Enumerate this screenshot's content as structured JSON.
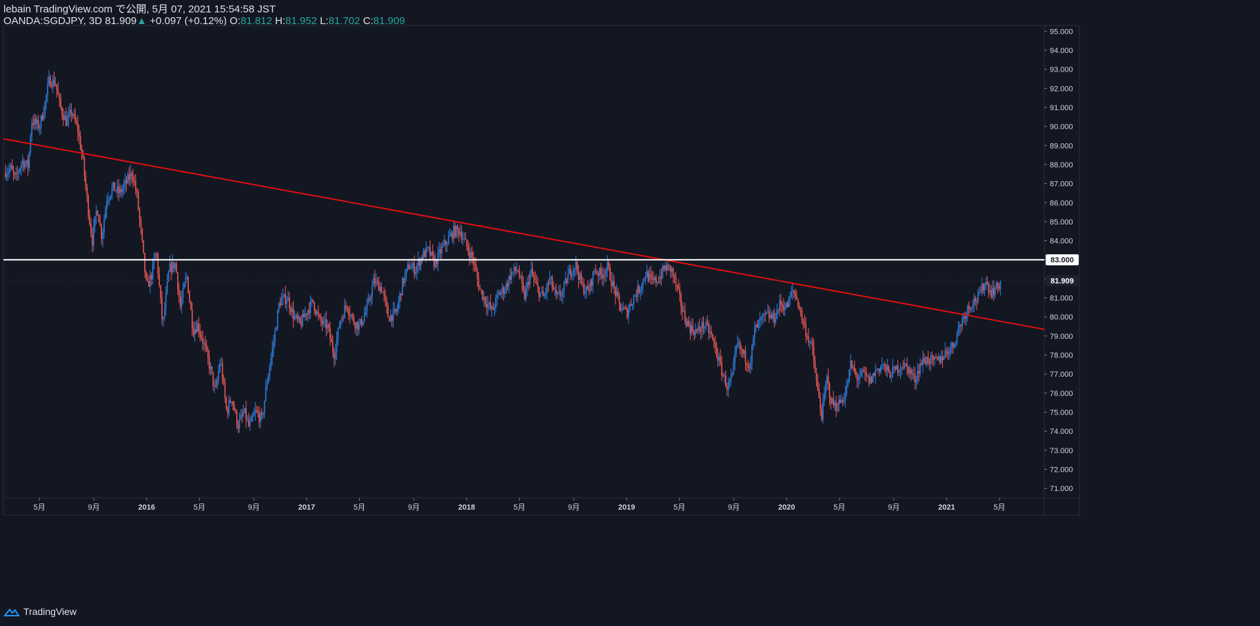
{
  "header": {
    "line1": "lebain TradingView.com で公開, 5月 07, 2021 15:54:58 JST",
    "symbol": "OANDA:SGDJPY, 3D",
    "last": "81.909",
    "change_arrow": "▲",
    "change": "+0.097 (+0.12%)",
    "o_label": "O:",
    "o_val": "81.812",
    "h_label": "H:",
    "h_val": "81.952",
    "l_label": "L:",
    "l_val": "81.702",
    "c_label": "C:",
    "c_val": "81.909"
  },
  "footer": {
    "brand": "TradingView"
  },
  "colors": {
    "background": "#131722",
    "up_candle": "#2f7fe0",
    "down_candle": "#f05a55",
    "trendline": "#e01010",
    "hline": "#ffffff",
    "axis_text": "#d1d4dc",
    "price_label_bg": "#ffffff",
    "last_label_bg": "#1e2230"
  },
  "chart_data": {
    "type": "candlestick",
    "symbol": "OANDA:SGDJPY",
    "timeframe": "3D",
    "ylim": [
      70.5,
      95.3
    ],
    "y_ticks": [
      "95.000",
      "94.000",
      "93.000",
      "92.000",
      "91.000",
      "90.000",
      "89.000",
      "88.000",
      "87.000",
      "86.000",
      "85.000",
      "84.000",
      "83.000",
      "82.000",
      "81.000",
      "80.000",
      "79.000",
      "78.000",
      "77.000",
      "76.000",
      "75.000",
      "74.000",
      "73.000",
      "72.000",
      "71.000"
    ],
    "x_ticks": [
      {
        "label": "5月",
        "year_frac": 2015.33
      },
      {
        "label": "9月",
        "year_frac": 2015.67
      },
      {
        "label": "2016",
        "year_frac": 2016.0
      },
      {
        "label": "5月",
        "year_frac": 2016.33
      },
      {
        "label": "9月",
        "year_frac": 2016.67
      },
      {
        "label": "2017",
        "year_frac": 2017.0
      },
      {
        "label": "5月",
        "year_frac": 2017.33
      },
      {
        "label": "9月",
        "year_frac": 2017.67
      },
      {
        "label": "2018",
        "year_frac": 2018.0
      },
      {
        "label": "5月",
        "year_frac": 2018.33
      },
      {
        "label": "9月",
        "year_frac": 2018.67
      },
      {
        "label": "2019",
        "year_frac": 2019.0
      },
      {
        "label": "5月",
        "year_frac": 2019.33
      },
      {
        "label": "9月",
        "year_frac": 2019.67
      },
      {
        "label": "2020",
        "year_frac": 2020.0
      },
      {
        "label": "5月",
        "year_frac": 2020.33
      },
      {
        "label": "9月",
        "year_frac": 2020.67
      },
      {
        "label": "2021",
        "year_frac": 2021.0
      },
      {
        "label": "5月",
        "year_frac": 2021.33
      }
    ],
    "x_range": [
      2015.105,
      2021.61
    ],
    "path_points": [
      [
        2015.11,
        87.6
      ],
      [
        2015.15,
        87.8
      ],
      [
        2015.18,
        87.2
      ],
      [
        2015.22,
        88.2
      ],
      [
        2015.26,
        87.9
      ],
      [
        2015.28,
        90.3
      ],
      [
        2015.33,
        90.0
      ],
      [
        2015.36,
        91.0
      ],
      [
        2015.39,
        92.4
      ],
      [
        2015.43,
        92.3
      ],
      [
        2015.46,
        91.0
      ],
      [
        2015.5,
        90.2
      ],
      [
        2015.53,
        90.8
      ],
      [
        2015.57,
        89.8
      ],
      [
        2015.6,
        88.3
      ],
      [
        2015.63,
        86.0
      ],
      [
        2015.66,
        84.0
      ],
      [
        2015.69,
        85.8
      ],
      [
        2015.72,
        84.2
      ],
      [
        2015.75,
        86.2
      ],
      [
        2015.79,
        86.8
      ],
      [
        2015.83,
        86.5
      ],
      [
        2015.87,
        87.0
      ],
      [
        2015.91,
        87.6
      ],
      [
        2015.94,
        86.3
      ],
      [
        2015.97,
        84.0
      ],
      [
        2016.0,
        81.5
      ],
      [
        2016.03,
        82.2
      ],
      [
        2016.06,
        83.5
      ],
      [
        2016.1,
        79.5
      ],
      [
        2016.14,
        82.5
      ],
      [
        2016.18,
        82.8
      ],
      [
        2016.21,
        80.5
      ],
      [
        2016.25,
        82.2
      ],
      [
        2016.29,
        79.3
      ],
      [
        2016.32,
        79.6
      ],
      [
        2016.36,
        78.5
      ],
      [
        2016.4,
        77.2
      ],
      [
        2016.43,
        76.0
      ],
      [
        2016.46,
        77.8
      ],
      [
        2016.5,
        75.0
      ],
      [
        2016.53,
        75.8
      ],
      [
        2016.57,
        74.3
      ],
      [
        2016.61,
        75.0
      ],
      [
        2016.64,
        74.2
      ],
      [
        2016.68,
        75.0
      ],
      [
        2016.72,
        74.6
      ],
      [
        2016.75,
        76.5
      ],
      [
        2016.79,
        78.5
      ],
      [
        2016.83,
        80.8
      ],
      [
        2016.88,
        81.0
      ],
      [
        2016.92,
        80.0
      ],
      [
        2016.96,
        79.6
      ],
      [
        2017.0,
        80.3
      ],
      [
        2017.04,
        80.8
      ],
      [
        2017.08,
        79.8
      ],
      [
        2017.13,
        79.5
      ],
      [
        2017.17,
        78.0
      ],
      [
        2017.21,
        79.8
      ],
      [
        2017.25,
        80.7
      ],
      [
        2017.29,
        79.8
      ],
      [
        2017.33,
        79.5
      ],
      [
        2017.38,
        80.5
      ],
      [
        2017.42,
        81.9
      ],
      [
        2017.47,
        81.5
      ],
      [
        2017.51,
        80.0
      ],
      [
        2017.56,
        80.2
      ],
      [
        2017.6,
        81.8
      ],
      [
        2017.64,
        82.7
      ],
      [
        2017.68,
        82.5
      ],
      [
        2017.72,
        83.2
      ],
      [
        2017.76,
        83.5
      ],
      [
        2017.8,
        82.8
      ],
      [
        2017.84,
        83.5
      ],
      [
        2017.88,
        84.0
      ],
      [
        2017.92,
        84.5
      ],
      [
        2017.96,
        84.5
      ],
      [
        2018.0,
        83.7
      ],
      [
        2018.04,
        83.0
      ],
      [
        2018.08,
        81.5
      ],
      [
        2018.12,
        80.8
      ],
      [
        2018.16,
        80.3
      ],
      [
        2018.2,
        81.2
      ],
      [
        2018.24,
        81.5
      ],
      [
        2018.28,
        82.3
      ],
      [
        2018.32,
        82.5
      ],
      [
        2018.36,
        81.0
      ],
      [
        2018.4,
        82.4
      ],
      [
        2018.44,
        81.5
      ],
      [
        2018.48,
        81.0
      ],
      [
        2018.52,
        82.0
      ],
      [
        2018.56,
        81.0
      ],
      [
        2018.6,
        81.3
      ],
      [
        2018.64,
        82.3
      ],
      [
        2018.68,
        82.8
      ],
      [
        2018.72,
        81.6
      ],
      [
        2018.76,
        81.3
      ],
      [
        2018.8,
        82.5
      ],
      [
        2018.84,
        82.2
      ],
      [
        2018.88,
        82.6
      ],
      [
        2018.92,
        81.5
      ],
      [
        2018.96,
        80.5
      ],
      [
        2019.0,
        80.2
      ],
      [
        2019.04,
        81.0
      ],
      [
        2019.08,
        81.5
      ],
      [
        2019.12,
        82.3
      ],
      [
        2019.16,
        81.8
      ],
      [
        2019.2,
        82.0
      ],
      [
        2019.24,
        82.6
      ],
      [
        2019.28,
        82.5
      ],
      [
        2019.32,
        81.3
      ],
      [
        2019.36,
        80.0
      ],
      [
        2019.4,
        79.4
      ],
      [
        2019.44,
        79.2
      ],
      [
        2019.48,
        79.6
      ],
      [
        2019.52,
        79.2
      ],
      [
        2019.56,
        78.2
      ],
      [
        2019.6,
        77.0
      ],
      [
        2019.63,
        76.3
      ],
      [
        2019.66,
        76.8
      ],
      [
        2019.69,
        78.6
      ],
      [
        2019.73,
        78.0
      ],
      [
        2019.77,
        77.5
      ],
      [
        2019.8,
        79.3
      ],
      [
        2019.84,
        79.8
      ],
      [
        2019.88,
        80.1
      ],
      [
        2019.92,
        79.9
      ],
      [
        2019.96,
        80.7
      ],
      [
        2020.0,
        80.5
      ],
      [
        2020.04,
        81.4
      ],
      [
        2020.07,
        80.8
      ],
      [
        2020.1,
        79.8
      ],
      [
        2020.13,
        79.0
      ],
      [
        2020.16,
        78.3
      ],
      [
        2020.19,
        76.3
      ],
      [
        2020.22,
        74.8
      ],
      [
        2020.25,
        76.8
      ],
      [
        2020.28,
        75.5
      ],
      [
        2020.31,
        75.3
      ],
      [
        2020.34,
        75.6
      ],
      [
        2020.37,
        76.0
      ],
      [
        2020.4,
        77.5
      ],
      [
        2020.44,
        76.8
      ],
      [
        2020.48,
        77.0
      ],
      [
        2020.52,
        76.6
      ],
      [
        2020.56,
        77.2
      ],
      [
        2020.6,
        77.5
      ],
      [
        2020.64,
        77.0
      ],
      [
        2020.68,
        77.2
      ],
      [
        2020.72,
        77.5
      ],
      [
        2020.76,
        77.3
      ],
      [
        2020.8,
        76.7
      ],
      [
        2020.84,
        77.6
      ],
      [
        2020.88,
        77.8
      ],
      [
        2020.92,
        77.6
      ],
      [
        2020.96,
        77.8
      ],
      [
        2021.0,
        78.2
      ],
      [
        2021.04,
        78.5
      ],
      [
        2021.08,
        79.5
      ],
      [
        2021.12,
        80.3
      ],
      [
        2021.16,
        80.8
      ],
      [
        2021.2,
        81.0
      ],
      [
        2021.24,
        81.9
      ],
      [
        2021.28,
        81.3
      ],
      [
        2021.32,
        81.6
      ],
      [
        2021.34,
        81.9
      ]
    ],
    "lines": [
      {
        "type": "trendline",
        "from": [
          2015.105,
          89.35
        ],
        "to": [
          2021.61,
          79.35
        ]
      },
      {
        "type": "horizontal",
        "price": 83.0,
        "label": "83.000"
      }
    ],
    "last_price_label": "81.909",
    "last_price": 81.909
  }
}
